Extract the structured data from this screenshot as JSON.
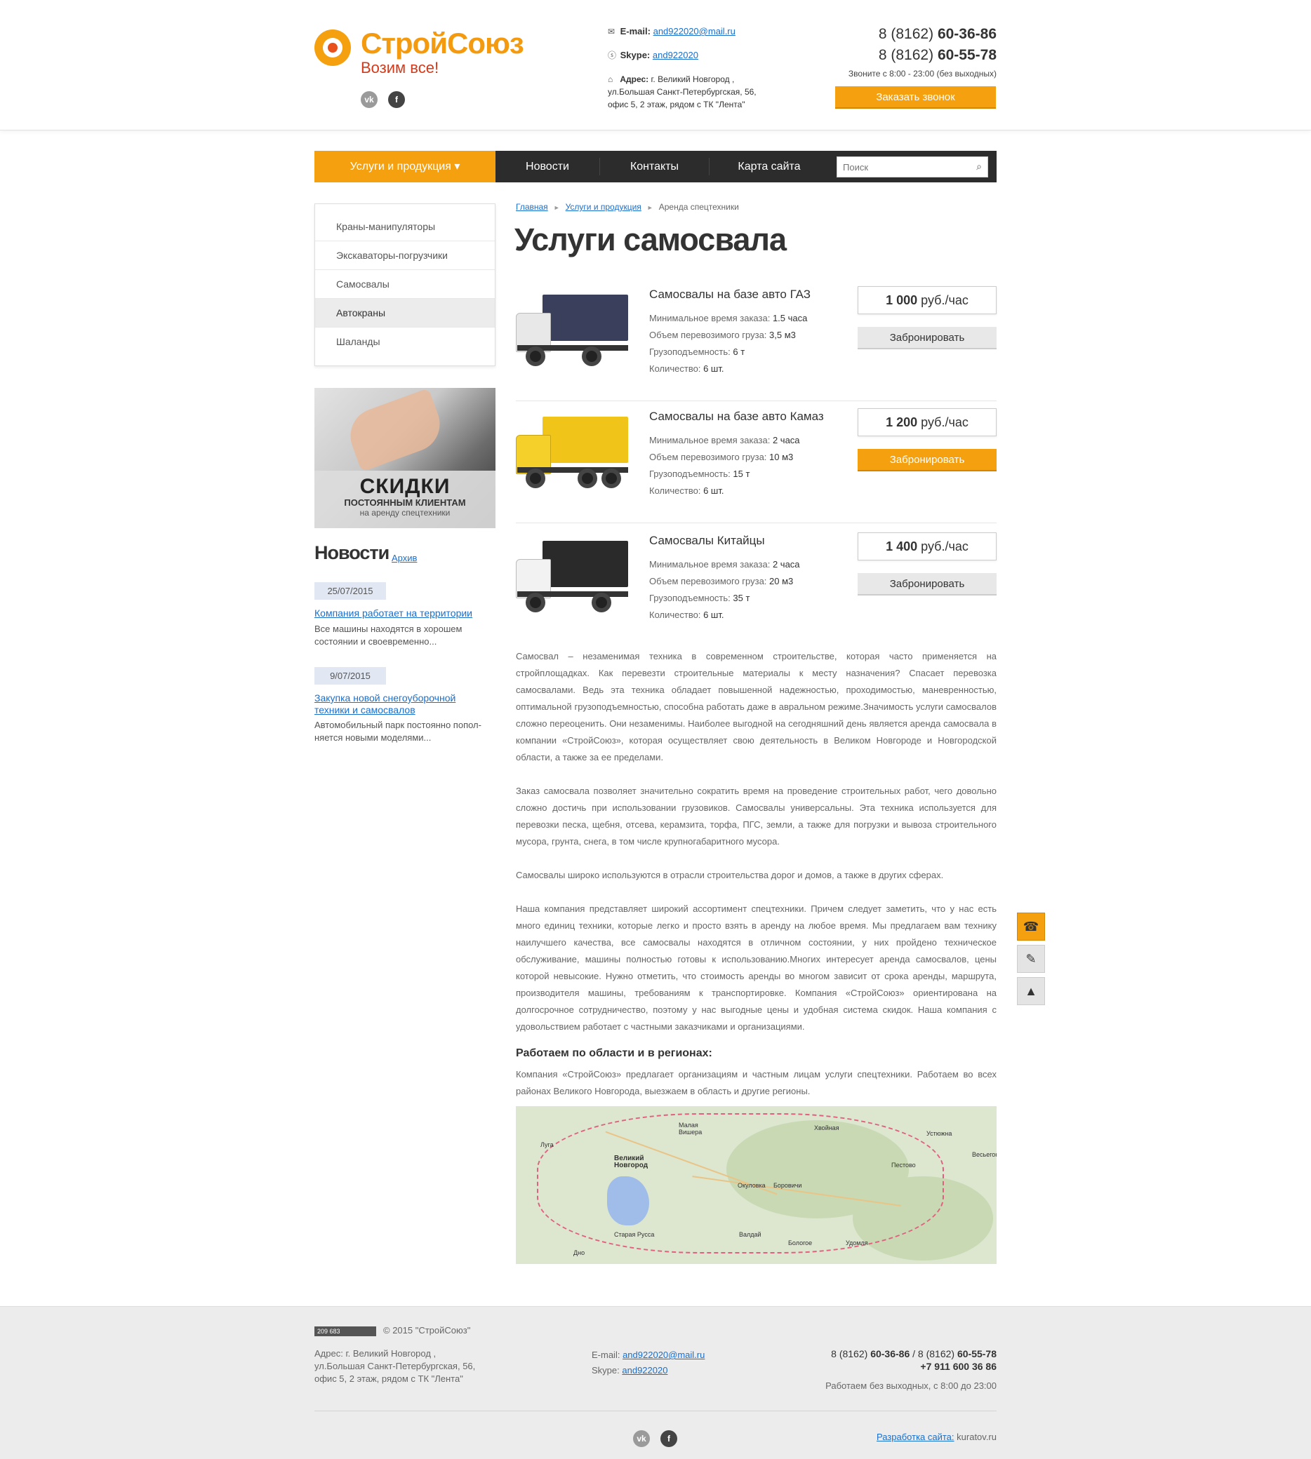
{
  "header": {
    "logo_name": "СтройСоюз",
    "logo_tagline": "Возим все!",
    "social": [
      "vk",
      "f"
    ],
    "email_label": "E-mail:",
    "email": "and922020@mail.ru",
    "skype_label": "Skype:",
    "skype": "and922020",
    "address_label": "Адрес:",
    "address_line1": "г. Великий Новгород ,",
    "address_line2": "ул.Большая Санкт-Петербургская, 56,",
    "address_line3": "офис 5, 2 этаж, рядом с ТК \"Лента\"",
    "phone1_prefix": "8 (8162)",
    "phone1_num": "60-36-86",
    "phone2_prefix": "8 (8162)",
    "phone2_num": "60-55-78",
    "hours_text": "Звоните с 8:00 - 23:00 (без выходных)",
    "call_button": "Заказать звонок"
  },
  "nav": {
    "items": [
      "Услуги и продукция ▾",
      "Новости",
      "Контакты",
      "Карта сайта"
    ],
    "search_placeholder": "Поиск"
  },
  "sidebar": {
    "items": [
      "Краны-манипуляторы",
      "Экскаваторы-погрузчики",
      "Самосвалы",
      "Автокраны",
      "Шаланды"
    ],
    "active_index": 3,
    "promo": {
      "line1": "СКИДКИ",
      "line2": "ПОСТОЯННЫМ КЛИЕНТАМ",
      "line3": "на аренду спецтехники"
    },
    "news_heading": "Новости",
    "news_archive": "Архив",
    "news": [
      {
        "date": "25/07/2015",
        "title": "Компания работает на территории",
        "text1": "Все машины находятся в хорошем",
        "text2": "состоянии и своевременно..."
      },
      {
        "date": "9/07/2015",
        "title1": "Закупка новой снегоуборочной",
        "title2": "техники и самосвалов",
        "text1": "Автомобильный парк постоянно попол-",
        "text2": "няется новыми моделями..."
      }
    ]
  },
  "breadcrumb": [
    "Главная",
    "Услуги и продукция",
    "Аренда спецтехники"
  ],
  "page_title": "Услуги самосвала",
  "products": [
    {
      "name": "Самосвалы на базе авто ГАЗ",
      "spec_labels": [
        "Минимальное время заказа:",
        "Объем перевозимого груза:",
        "Грузоподъемность:",
        "Количество:"
      ],
      "spec_values": [
        "1.5 часа",
        "3,5 м3",
        "6 т",
        "6 шт."
      ],
      "price_amount": "1 000",
      "price_unit": "руб./час",
      "button": "Забронировать",
      "truck_color": "#3a3f5c",
      "cab_color": "#e8e8e8"
    },
    {
      "name": "Самосвалы на базе авто Камаз",
      "spec_labels": [
        "Минимальное время заказа:",
        "Объем перевозимого груза:",
        "Грузоподъемность:",
        "Количество:"
      ],
      "spec_values": [
        "2 часа",
        "10 м3",
        "15 т",
        "6 шт."
      ],
      "price_amount": "1 200",
      "price_unit": "руб./час",
      "button": "Забронировать",
      "truck_color": "#f0c419",
      "cab_color": "#f5d02a"
    },
    {
      "name": "Самосвалы Китайцы",
      "spec_labels": [
        "Минимальное время заказа:",
        "Объем перевозимого груза:",
        "Грузоподъемность:",
        "Количество:"
      ],
      "spec_values": [
        "2 часа",
        "20 м3",
        "35 т",
        "6 шт."
      ],
      "price_amount": "1 400",
      "price_unit": "руб./час",
      "button": "Забронировать",
      "truck_color": "#2a2a2a",
      "cab_color": "#f2f2f2"
    }
  ],
  "article": {
    "p1": "Самосвал – незаменимая техника в современном строительстве, которая часто применяется на стройплощадках. Как перевезти строительные материалы к месту назначения? Спасает перевозка самосвалами. Ведь эта техника обладает повышенной надежностью, проходимостью, маневренностью, оптимальной грузоподъемностью, способна работать даже в авральном режиме.Значимость услуги самосвалов сложно переоценить. Они незаменимы. Наиболее выгодной на сегодняшний день является аренда самосвала в компании «СтройСоюз», которая осуществляет свою деятельность в Великом Новгороде и Новгородской области, а также за ее пределами.",
    "p2": "Заказ самосвала позволяет значительно сократить время на проведение строительных работ, чего довольно сложно достичь при использовании грузовиков. Самосвалы универсальны. Эта техника используется для перевозки песка, щебня, отсева, керамзита, торфа, ПГС, земли, а также для погрузки и вывоза строительного мусора, грунта, снега, в том числе крупногабаритного мусора.",
    "p3": "Самосвалы широко используются в отрасли строительства дорог и домов, а также в других сферах.",
    "p4": "Наша компания представляет широкий ассортимент спецтехники. Причем следует заметить, что у нас есть много единиц техники, которые легко и просто взять в аренду на любое время. Мы предлагаем вам технику наилучшего качества, все самосвалы находятся в отличном состоянии, у них пройдено техническое обслуживание, машины полностью готовы к использованию.Многих интересует аренда самосвалов, цены которой невысокие. Нужно отметить, что стоимость аренды во многом зависит от срока аренды, маршрута, производителя машины, требованиям к транспортировке. Компания «СтройСоюз» ориентирована на долгосрочное сотрудничество, поэтому у нас выгодные цены и удобная система скидок. Наша компания с удовольствием работает с частными заказчиками и организациями.",
    "h3": "Работаем по области и в регионах:",
    "p5": "Компания «СтройСоюз» предлагает организациям и частным лицам услуги спецтехники. Работаем во всех районах Великого Новгорода, выезжаем в область и другие регионы."
  },
  "map_cities": [
    "Малая Вишера",
    "Хвойная",
    "Устюжна",
    "Луга",
    "Великий Новгород",
    "Пестово",
    "Весьегонск",
    "Окуловка",
    "Боровичи",
    "Старая Русса",
    "Валдай",
    "Бологое",
    "Удомля",
    "Дно"
  ],
  "floating": {
    "call": "☎",
    "write": "✎",
    "up": "▲"
  },
  "footer": {
    "counter": "209 683",
    "copyright": "© 2015 \"СтройСоюз\"",
    "addr1": "Адрес: г. Великий Новгород ,",
    "addr2": "ул.Большая Санкт-Петербургская, 56,",
    "addr3": "офис 5, 2 этаж, рядом с ТК \"Лента\"",
    "email_label": "E-mail:",
    "email": "and922020@mail.ru",
    "skype_label": "Skype:",
    "skype": "and922020",
    "phone_pre1": "8 (8162)",
    "phone_num1": "60-36-86",
    "phone_sep": "/",
    "phone_pre2": "8 (8162)",
    "phone_num2": "60-55-78",
    "mobile": "+7 911 600 36 86",
    "hours": "Работаем без выходных, с 8:00 до 23:00",
    "dev_link": "Разработка сайта:",
    "dev_name": "kuratov.ru"
  },
  "colors": {
    "accent": "#f5a00f",
    "nav_bg": "#2c2c2c",
    "link": "#1a6fcc"
  }
}
